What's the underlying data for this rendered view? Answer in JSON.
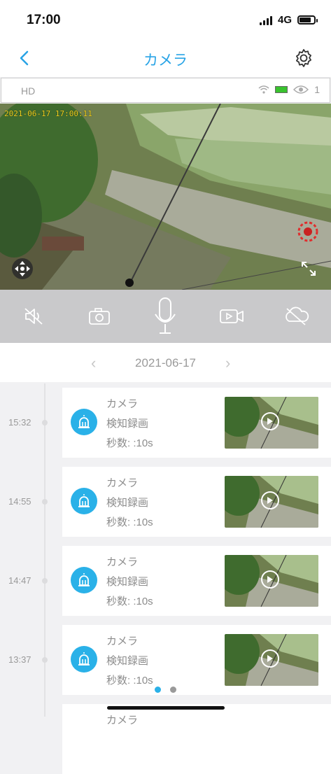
{
  "status_bar": {
    "time": "17:00",
    "network": "4G"
  },
  "nav": {
    "title": "カメラ",
    "back_icon": "chevron-left-icon",
    "settings_icon": "gear-icon"
  },
  "camera_header": {
    "quality": "HD",
    "viewer_count": "1"
  },
  "video": {
    "timestamp": "2021-06-17 17:00:11"
  },
  "controls": [
    {
      "name": "mute",
      "icon": "speaker-mute-icon"
    },
    {
      "name": "snapshot",
      "icon": "camera-icon"
    },
    {
      "name": "talk",
      "icon": "microphone-icon"
    },
    {
      "name": "record",
      "icon": "video-record-icon"
    },
    {
      "name": "cloud",
      "icon": "cloud-off-icon"
    }
  ],
  "date_bar": {
    "date": "2021-06-17"
  },
  "records": [
    {
      "time": "15:32",
      "title": "カメラ",
      "type": "検知録画",
      "duration": "秒数: :10s"
    },
    {
      "time": "14:55",
      "title": "カメラ",
      "type": "検知録画",
      "duration": "秒数: :10s"
    },
    {
      "time": "14:47",
      "title": "カメラ",
      "type": "検知録画",
      "duration": "秒数: :10s"
    },
    {
      "time": "13:37",
      "title": "カメラ",
      "type": "検知録画",
      "duration": "秒数: :10s"
    }
  ],
  "next_record_partial": {
    "title": "カメラ"
  },
  "colors": {
    "accent": "#29a4e6",
    "alarm_blue": "#2ab1e8",
    "control_bar": "#c9c9cb",
    "osd_yellow": "#f2d21f"
  }
}
